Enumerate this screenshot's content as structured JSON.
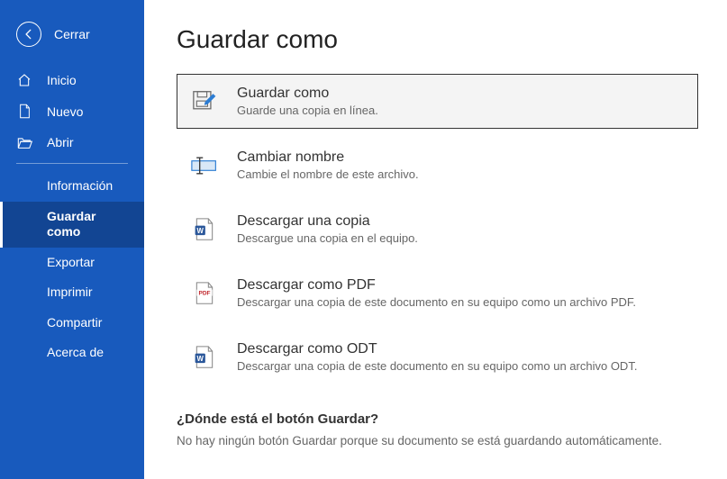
{
  "sidebar": {
    "close": "Cerrar",
    "nav": {
      "home": "Inicio",
      "new": "Nuevo",
      "open": "Abrir"
    },
    "sub": {
      "info": "Información",
      "save_as": "Guardar como",
      "export": "Exportar",
      "print": "Imprimir",
      "share": "Compartir",
      "about": "Acerca de"
    }
  },
  "page": {
    "title": "Guardar como",
    "options": {
      "save_as": {
        "title": "Guardar como",
        "desc": "Guarde una copia en línea."
      },
      "rename": {
        "title": "Cambiar nombre",
        "desc": "Cambie el nombre de este archivo."
      },
      "download": {
        "title": "Descargar una copia",
        "desc": "Descargue una copia en el equipo."
      },
      "download_pdf": {
        "title": "Descargar como PDF",
        "desc": "Descargar una copia de este documento en su equipo como un archivo PDF."
      },
      "download_odt": {
        "title": "Descargar como ODT",
        "desc": "Descargar una copia de este documento en su equipo como un archivo ODT."
      }
    },
    "footer": {
      "question": "¿Dónde está el botón Guardar?",
      "answer": "No hay ningún botón Guardar porque su documento se está guardando automáticamente."
    }
  }
}
